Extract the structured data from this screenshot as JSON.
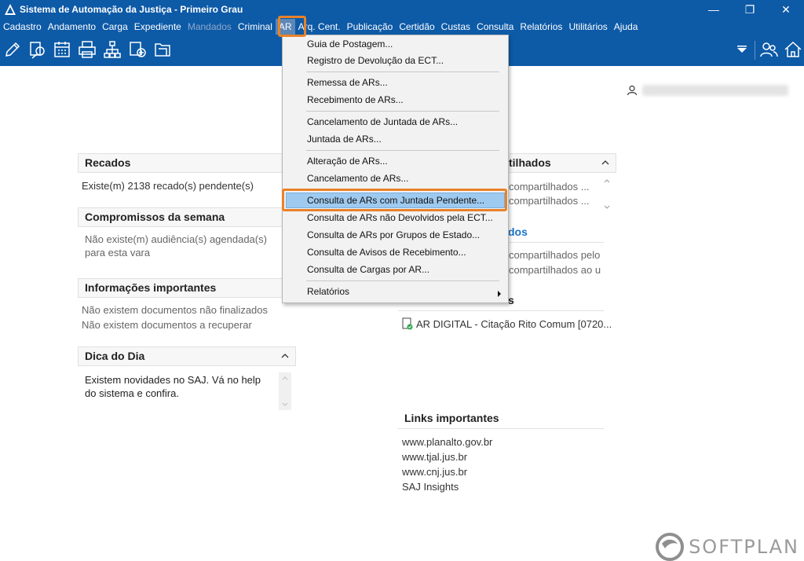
{
  "window": {
    "title": "Sistema de Automação da Justiça - Primeiro Grau",
    "minimize": "—",
    "maximize": "❐",
    "close": "✕"
  },
  "menubar": {
    "items": [
      {
        "label": "Cadastro"
      },
      {
        "label": "Andamento"
      },
      {
        "label": "Carga"
      },
      {
        "label": "Expediente"
      },
      {
        "label": "Mandados",
        "disabled": true
      },
      {
        "label": "Criminal"
      },
      {
        "label": "AR",
        "active": true
      },
      {
        "label": "Arq. Cent."
      },
      {
        "label": "Publicação"
      },
      {
        "label": "Certidão"
      },
      {
        "label": "Custas"
      },
      {
        "label": "Consulta"
      },
      {
        "label": "Relatórios"
      },
      {
        "label": "Utilitários"
      },
      {
        "label": "Ajuda"
      }
    ]
  },
  "toolbar": {
    "icons": [
      "edit-icon",
      "search-document-icon",
      "calendar-icon",
      "printer-icon",
      "org-chart-icon",
      "process-add-icon",
      "folder-icon",
      "dropdown-arrow-icon",
      "users-icon",
      "home-icon"
    ]
  },
  "ar_menu": {
    "items": [
      "Guia de Postagem...",
      "Registro de Devolução da ECT...",
      "Remessa de ARs...",
      "Recebimento de ARs...",
      "Cancelamento de Juntada de ARs...",
      "Juntada de ARs...",
      "Alteração de ARs...",
      "Cancelamento de ARs...",
      "Consulta de ARs com Juntada Pendente...",
      "Consulta de ARs não Devolvidos pela ECT...",
      "Consulta de ARs por Grupos de Estado...",
      "Consulta de Avisos de Recebimento...",
      "Consulta de Cargas por AR...",
      "Relatórios"
    ],
    "selected_index": 8
  },
  "panels": {
    "recados": {
      "title": "Recados",
      "text": "Existe(m) 2138 recado(s) pendente(s)"
    },
    "compromissos": {
      "title": "Compromissos da semana",
      "text1": "Não existe(m) audiência(s) agendada(s)",
      "text2": "para esta vara"
    },
    "informacoes": {
      "title": "Informações importantes",
      "text1": "Não existem documentos não finalizados",
      "text2": "Não existem documentos a recuperar"
    },
    "dica": {
      "title": "Dica do Dia",
      "text1": "Existem novidades no SAJ. Vá no help",
      "text2": "do sistema e confira."
    },
    "right_partial": {
      "head1": "tilhados",
      "line1": "compartilhados ...",
      "line2": "compartilhados ...",
      "head2": "dos",
      "line3": "compartilhados pelo",
      "line4": "compartilhados ao u",
      "head3": "s",
      "doc": "AR DIGITAL - Citação Rito Comum [0720..."
    },
    "links": {
      "title": "Links importantes",
      "items": [
        "www.planalto.gov.br",
        "www.tjal.jus.br",
        "www.cnj.jus.br",
        "SAJ Insights"
      ]
    }
  },
  "brand": {
    "name": "SOFTPLAN"
  }
}
